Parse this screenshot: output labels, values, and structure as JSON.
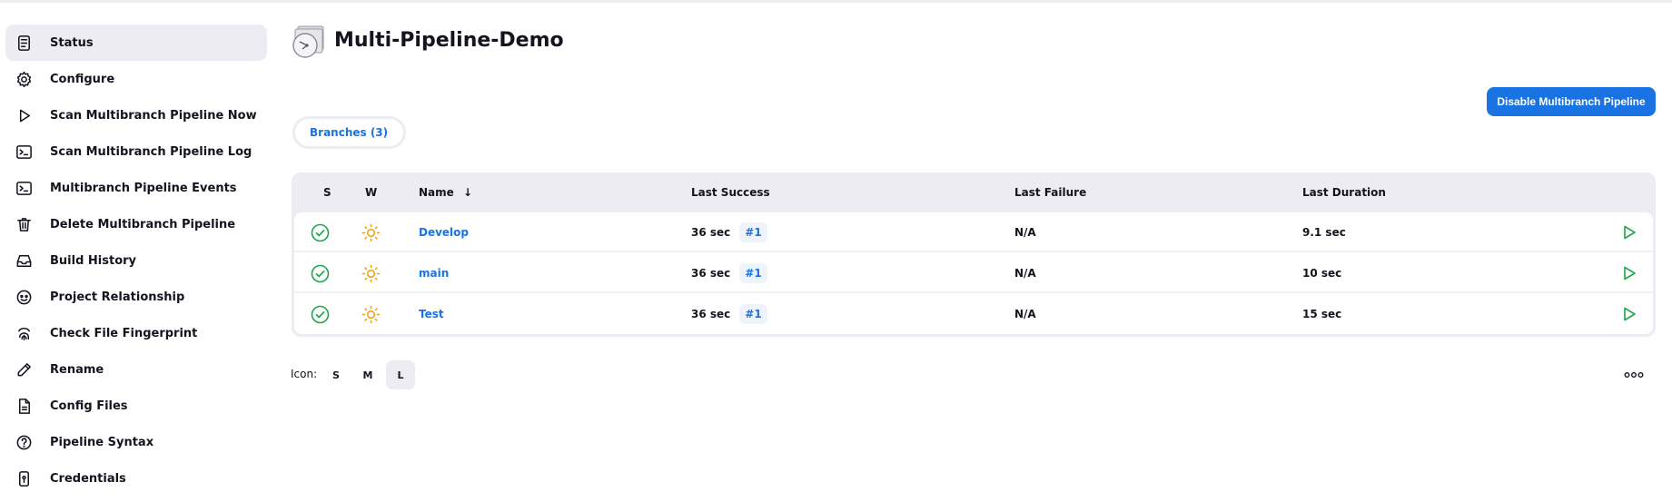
{
  "sidebar": {
    "items": [
      {
        "label": "Status",
        "icon": "status-icon",
        "active": true
      },
      {
        "label": "Configure",
        "icon": "gear-icon"
      },
      {
        "label": "Scan Multibranch Pipeline Now",
        "icon": "play-icon"
      },
      {
        "label": "Scan Multibranch Pipeline Log",
        "icon": "terminal-icon"
      },
      {
        "label": "Multibranch Pipeline Events",
        "icon": "terminal-icon"
      },
      {
        "label": "Delete Multibranch Pipeline",
        "icon": "trash-icon"
      },
      {
        "label": "Build History",
        "icon": "inbox-icon"
      },
      {
        "label": "Project Relationship",
        "icon": "relationship-icon"
      },
      {
        "label": "Check File Fingerprint",
        "icon": "fingerprint-icon"
      },
      {
        "label": "Rename",
        "icon": "pencil-icon"
      },
      {
        "label": "Config Files",
        "icon": "file-icon"
      },
      {
        "label": "Pipeline Syntax",
        "icon": "help-icon"
      },
      {
        "label": "Credentials",
        "icon": "credentials-icon"
      }
    ]
  },
  "header": {
    "title": "Multi-Pipeline-Demo",
    "disable_button": "Disable Multibranch Pipeline"
  },
  "tabs": [
    {
      "label": "Branches (3)",
      "active": true
    }
  ],
  "table": {
    "columns": {
      "s": "S",
      "w": "W",
      "name": "Name",
      "name_sort": "↓",
      "last_success": "Last Success",
      "last_failure": "Last Failure",
      "last_duration": "Last Duration"
    },
    "rows": [
      {
        "name": "Develop",
        "last_success": "36 sec",
        "build": "#1",
        "last_failure": "N/A",
        "last_duration": "9.1 sec",
        "status": "success",
        "weather": "sunny"
      },
      {
        "name": "main",
        "last_success": "36 sec",
        "build": "#1",
        "last_failure": "N/A",
        "last_duration": "10 sec",
        "status": "success",
        "weather": "sunny"
      },
      {
        "name": "Test",
        "last_success": "36 sec",
        "build": "#1",
        "last_failure": "N/A",
        "last_duration": "15 sec",
        "status": "success",
        "weather": "sunny"
      }
    ]
  },
  "footer": {
    "icon_label": "Icon:",
    "sizes": [
      "S",
      "M",
      "L"
    ],
    "selected_size": "L"
  },
  "colors": {
    "accent": "#1973e3",
    "success": "#1ea64b",
    "sunny": "#f0a000"
  }
}
